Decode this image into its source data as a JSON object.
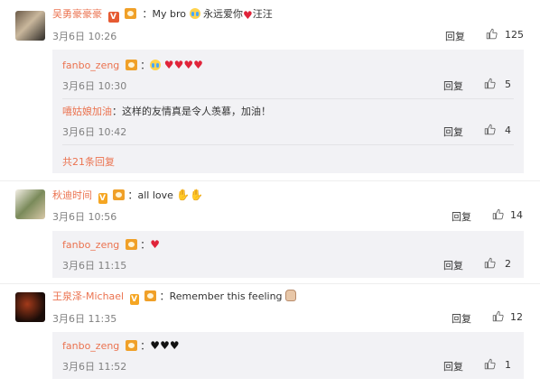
{
  "comments": [
    {
      "user": "吴勇豪豪豪",
      "text": "My bro",
      "text_tail": "永远爱你",
      "text_tail2": "汪汪",
      "date": "3月6日 10:26",
      "reply_label": "回复",
      "likes": "125",
      "replies": [
        {
          "user": "fanbo_zeng",
          "text": "",
          "date": "3月6日 10:30",
          "reply_label": "回复",
          "likes": "5"
        },
        {
          "user": "嘻姑娘加油",
          "text": "：这样的友情真是令人羡慕，加油！",
          "date": "3月6日 10:42",
          "reply_label": "回复",
          "likes": "4"
        }
      ],
      "more_replies": "共21条回复"
    },
    {
      "user": "秋迪时间",
      "text": "all love",
      "date": "3月6日 10:56",
      "reply_label": "回复",
      "likes": "14",
      "replies": [
        {
          "user": "fanbo_zeng",
          "text": "",
          "date": "3月6日 11:15",
          "reply_label": "回复",
          "likes": "2"
        }
      ]
    },
    {
      "user": "王泉泽-Michael",
      "text": "Remember this feeling",
      "date": "3月6日 11:35",
      "reply_label": "回复",
      "likes": "12",
      "replies": [
        {
          "user": "fanbo_zeng",
          "text": "",
          "date": "3月6日 11:52",
          "reply_label": "回复",
          "likes": "1"
        }
      ]
    }
  ],
  "colors": {
    "username": "#eb7350",
    "reply_bg": "#f2f2f5",
    "heart": "#e0243a"
  },
  "icons": [
    "thumbs-up-icon",
    "verified-v-icon",
    "crown-badge-icon",
    "crying-face-icon",
    "red-heart-icon",
    "black-heart-icon",
    "rock-hand-icon",
    "fist-icon"
  ]
}
